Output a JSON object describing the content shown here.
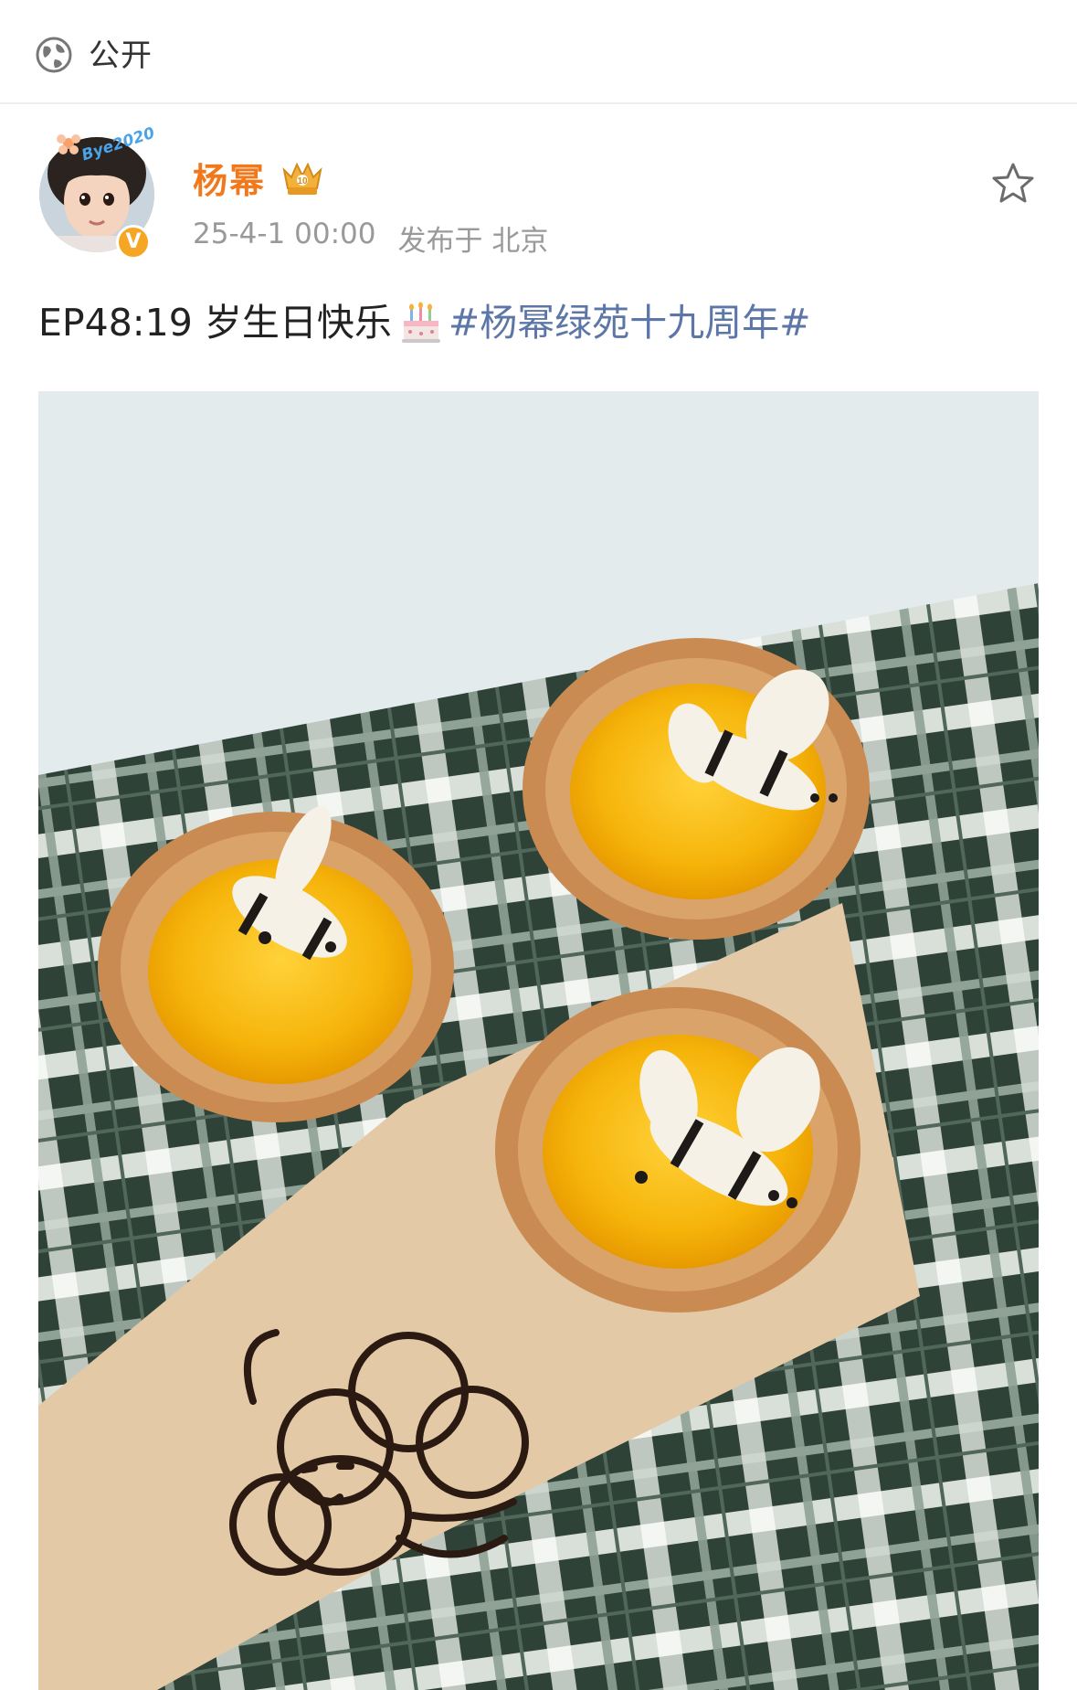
{
  "visibility": {
    "icon": "globe-icon",
    "label": "公开"
  },
  "post": {
    "author": {
      "name": "杨幂",
      "avatar_frame_text": "Bye2020",
      "verified_badge": "V",
      "vip_badge_icon": "crown-badge-icon"
    },
    "meta": {
      "time": "25-4-1 00:00",
      "location": "发布于 北京"
    },
    "favorite_icon": "star-outline-icon",
    "text": {
      "main": "EP48:19 岁生日快乐",
      "emoji": "cake-icon",
      "hashtag": "#杨幂绿苑十九周年#"
    },
    "photo": {
      "subject": "photo-bee-tarts"
    }
  },
  "colors": {
    "username": "#f2791b",
    "hashtag": "#5d76a8",
    "meta": "#999999",
    "verified": "#f5a623"
  }
}
